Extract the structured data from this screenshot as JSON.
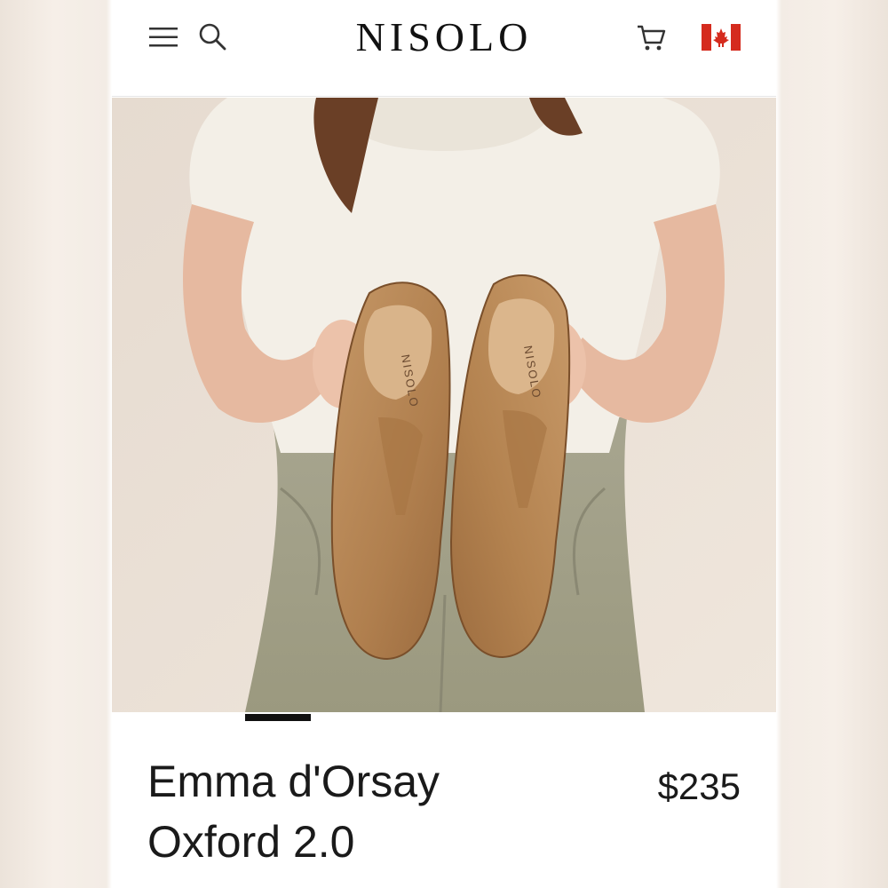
{
  "header": {
    "brand": "NISOLO",
    "icons": [
      "menu-icon",
      "search-icon",
      "cart-icon",
      "canada-flag-icon"
    ]
  },
  "hero": {
    "shoe_insole_text": "NISOLO",
    "carousel": {
      "current_slide": 1
    }
  },
  "product": {
    "title_line1": "Emma d'Orsay",
    "title_line2": "Oxford 2.0",
    "price": "$235"
  },
  "colors": {
    "flag_red": "#d52b1e",
    "leather": "#b98a58",
    "background": "#e9dfd5"
  }
}
